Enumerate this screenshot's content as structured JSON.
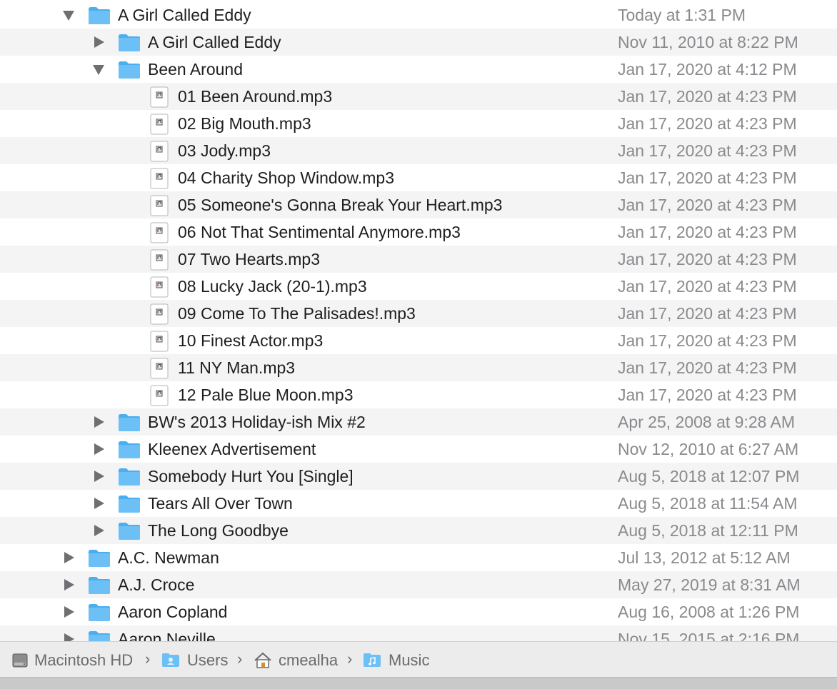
{
  "list": {
    "rows": [
      {
        "kind": "folder",
        "expanded": true,
        "name": "A Girl Called Eddy",
        "date": "Today at 1:31 PM"
      },
      {
        "kind": "folder",
        "expanded": false,
        "name": "A Girl Called Eddy",
        "date": "Nov 11, 2010 at 8:22 PM"
      },
      {
        "kind": "folder",
        "expanded": true,
        "name": "Been Around",
        "date": "Jan 17, 2020 at 4:12 PM"
      },
      {
        "kind": "file",
        "name": "01 Been Around.mp3",
        "date": "Jan 17, 2020 at 4:23 PM"
      },
      {
        "kind": "file",
        "name": "02 Big Mouth.mp3",
        "date": "Jan 17, 2020 at 4:23 PM"
      },
      {
        "kind": "file",
        "name": "03 Jody.mp3",
        "date": "Jan 17, 2020 at 4:23 PM"
      },
      {
        "kind": "file",
        "name": "04 Charity Shop Window.mp3",
        "date": "Jan 17, 2020 at 4:23 PM"
      },
      {
        "kind": "file",
        "name": "05 Someone's Gonna Break Your Heart.mp3",
        "date": "Jan 17, 2020 at 4:23 PM"
      },
      {
        "kind": "file",
        "name": "06 Not That Sentimental Anymore.mp3",
        "date": "Jan 17, 2020 at 4:23 PM"
      },
      {
        "kind": "file",
        "name": "07 Two Hearts.mp3",
        "date": "Jan 17, 2020 at 4:23 PM"
      },
      {
        "kind": "file",
        "name": "08 Lucky Jack (20-1).mp3",
        "date": "Jan 17, 2020 at 4:23 PM"
      },
      {
        "kind": "file",
        "name": "09 Come To The Palisades!.mp3",
        "date": "Jan 17, 2020 at 4:23 PM"
      },
      {
        "kind": "file",
        "name": "10 Finest Actor.mp3",
        "date": "Jan 17, 2020 at 4:23 PM"
      },
      {
        "kind": "file",
        "name": "11 NY Man.mp3",
        "date": "Jan 17, 2020 at 4:23 PM"
      },
      {
        "kind": "file",
        "name": "12 Pale Blue Moon.mp3",
        "date": "Jan 17, 2020 at 4:23 PM"
      },
      {
        "kind": "folder",
        "expanded": false,
        "name": "BW's 2013 Holiday-ish Mix #2",
        "date": "Apr 25, 2008 at 9:28 AM"
      },
      {
        "kind": "folder",
        "expanded": false,
        "name": "Kleenex Advertisement",
        "date": "Nov 12, 2010 at 6:27 AM"
      },
      {
        "kind": "folder",
        "expanded": false,
        "name": "Somebody Hurt You [Single]",
        "date": "Aug 5, 2018 at 12:07 PM"
      },
      {
        "kind": "folder",
        "expanded": false,
        "name": "Tears All Over Town",
        "date": "Aug 5, 2018 at 11:54 AM"
      },
      {
        "kind": "folder",
        "expanded": false,
        "name": "The Long Goodbye",
        "date": "Aug 5, 2018 at 12:11 PM"
      },
      {
        "kind": "folder",
        "expanded": false,
        "name": "A.C. Newman",
        "date": "Jul 13, 2012 at 5:12 AM"
      },
      {
        "kind": "folder",
        "expanded": false,
        "name": "A.J. Croce",
        "date": "May 27, 2019 at 8:31 AM"
      },
      {
        "kind": "folder",
        "expanded": false,
        "name": "Aaron Copland",
        "date": "Aug 16, 2008 at 1:26 PM"
      },
      {
        "kind": "folder",
        "expanded": false,
        "name": "Aaron Neville",
        "date": "Nov 15, 2015 at 2:16 PM"
      }
    ]
  },
  "pathbar": {
    "crumbs": [
      {
        "label": "Macintosh HD",
        "icon": "hard-drive-icon"
      },
      {
        "label": "Users",
        "icon": "users-folder-icon"
      },
      {
        "label": "cmealha",
        "icon": "home-icon"
      },
      {
        "label": "Music",
        "icon": "music-folder-icon"
      }
    ],
    "separator": "›"
  },
  "colors": {
    "folder": "#6cc0f5",
    "folder_tab": "#4aaeef",
    "alt_row": "#f4f4f5",
    "date_text": "#8a8a8e",
    "disclosure": "#6e6e73"
  }
}
